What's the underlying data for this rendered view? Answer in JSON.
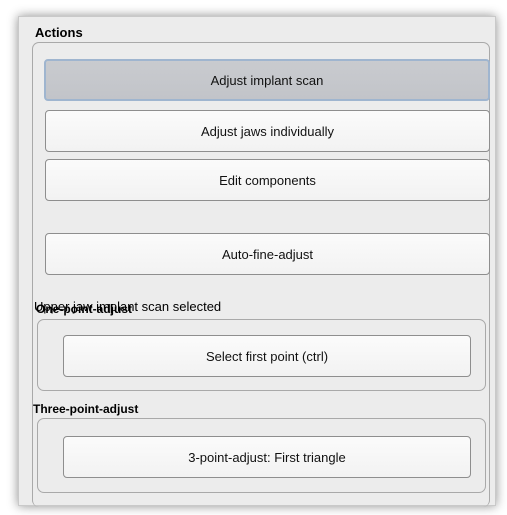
{
  "panel": {
    "title": "Actions"
  },
  "buttons": {
    "adjust_implant_scan": "Adjust implant scan",
    "adjust_jaws_individually": "Adjust jaws individually",
    "edit_components": "Edit components",
    "auto_fine_adjust": "Auto-fine-adjust"
  },
  "status_text": "Upper jaw implant scan selected",
  "one_point": {
    "title": "One-point-adjust",
    "button": "Select first point (ctrl)"
  },
  "three_point": {
    "title": "Three-point-adjust",
    "button": "3-point-adjust: First triangle"
  },
  "colors": {
    "selected_button": "#c4c6cb",
    "selected_border": "#9fb5cf",
    "panel_background": "#ececec"
  }
}
